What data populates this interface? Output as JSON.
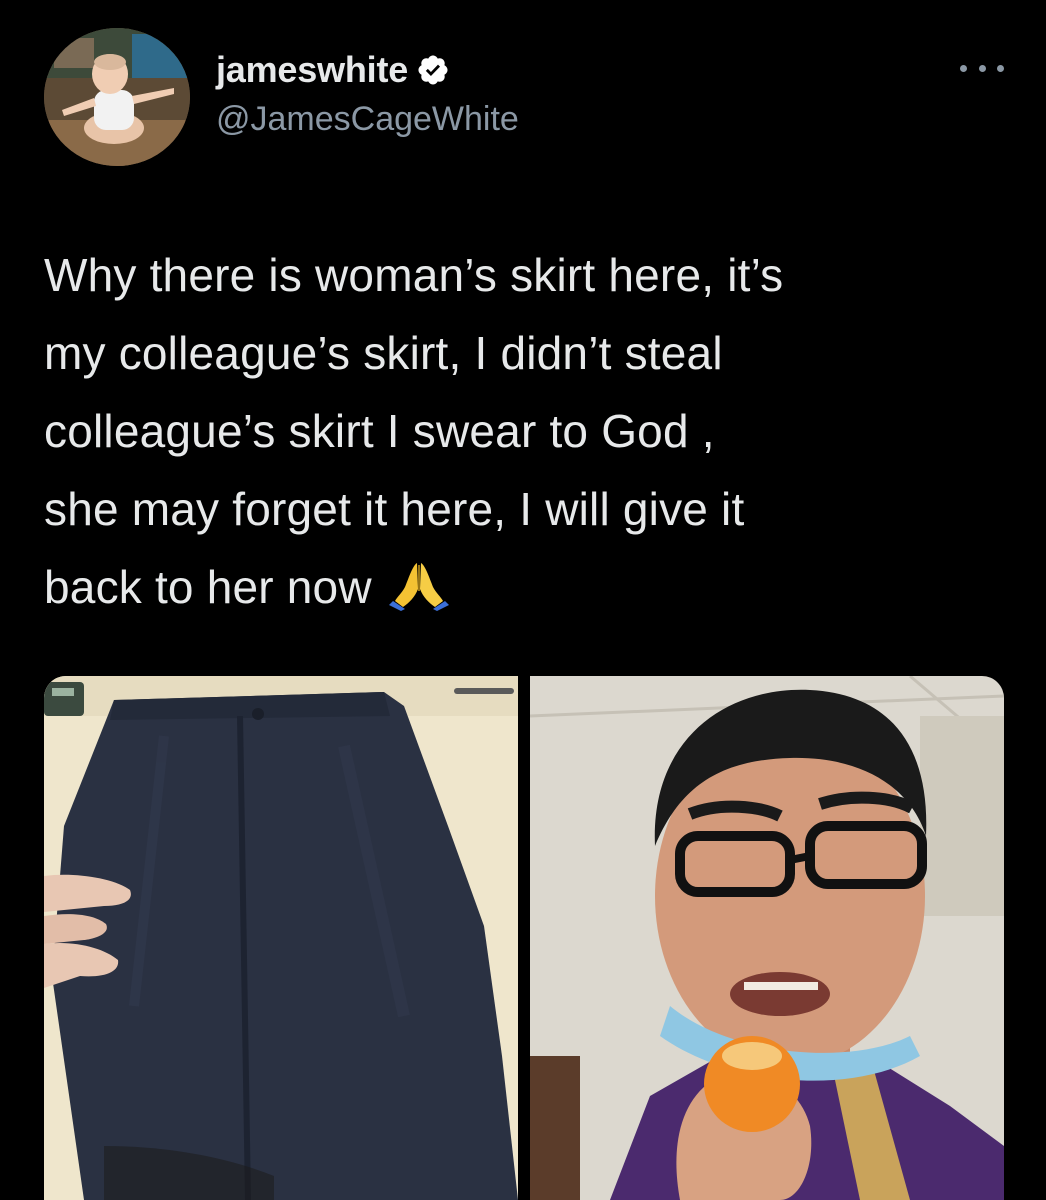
{
  "tweet": {
    "display_name": "jameswhite",
    "handle": "@JamesCageWhite",
    "verified": true,
    "text_lines": [
      "Why there is woman’s skirt here, it’s",
      "my colleague’s skirt, I didn’t steal",
      "colleague’s skirt I swear to God ,",
      "she may forget it here, I will give it",
      "back to her now"
    ],
    "text_emoji": "folded-hands"
  },
  "icons": {
    "more": "more-horizontal-icon",
    "verified": "verified-badge-icon"
  },
  "colors": {
    "background": "#000000",
    "primary_text": "#e7e9ea",
    "secondary_text": "#8b98a5",
    "verified_badge": "#ffffff"
  },
  "media": [
    {
      "kind": "photo",
      "subject": "skirt-photo"
    },
    {
      "kind": "photo",
      "subject": "man-eating-orange-photo"
    }
  ]
}
